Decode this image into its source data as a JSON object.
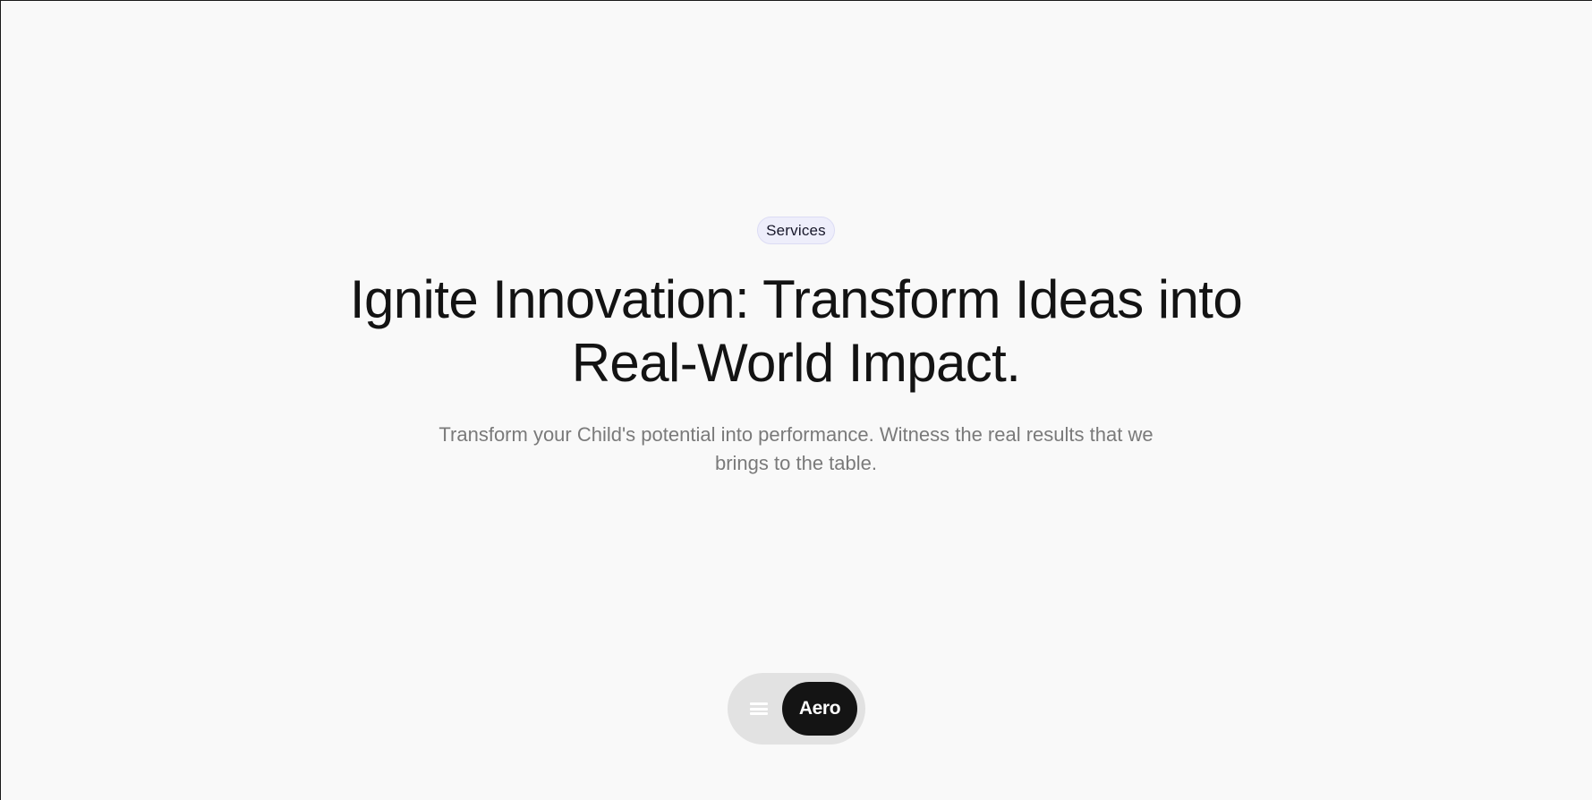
{
  "hero": {
    "badge": "Services",
    "title_line1": "Ignite Innovation: Transform Ideas into",
    "title_line2": "Real-World Impact.",
    "subtitle_line1": "Transform your Child's potential into performance. Witness the real results that we",
    "subtitle_line2": "brings to the table."
  },
  "nav": {
    "menu_icon": "hamburger-menu-icon",
    "brand_label": "Aero"
  },
  "colors": {
    "background": "#f9f9f9",
    "text": "#131313",
    "muted_text": "#7a7a7a",
    "badge_background": "#eeeefb",
    "nav_background": "#e2e2e2",
    "brand_button": "#141414"
  }
}
